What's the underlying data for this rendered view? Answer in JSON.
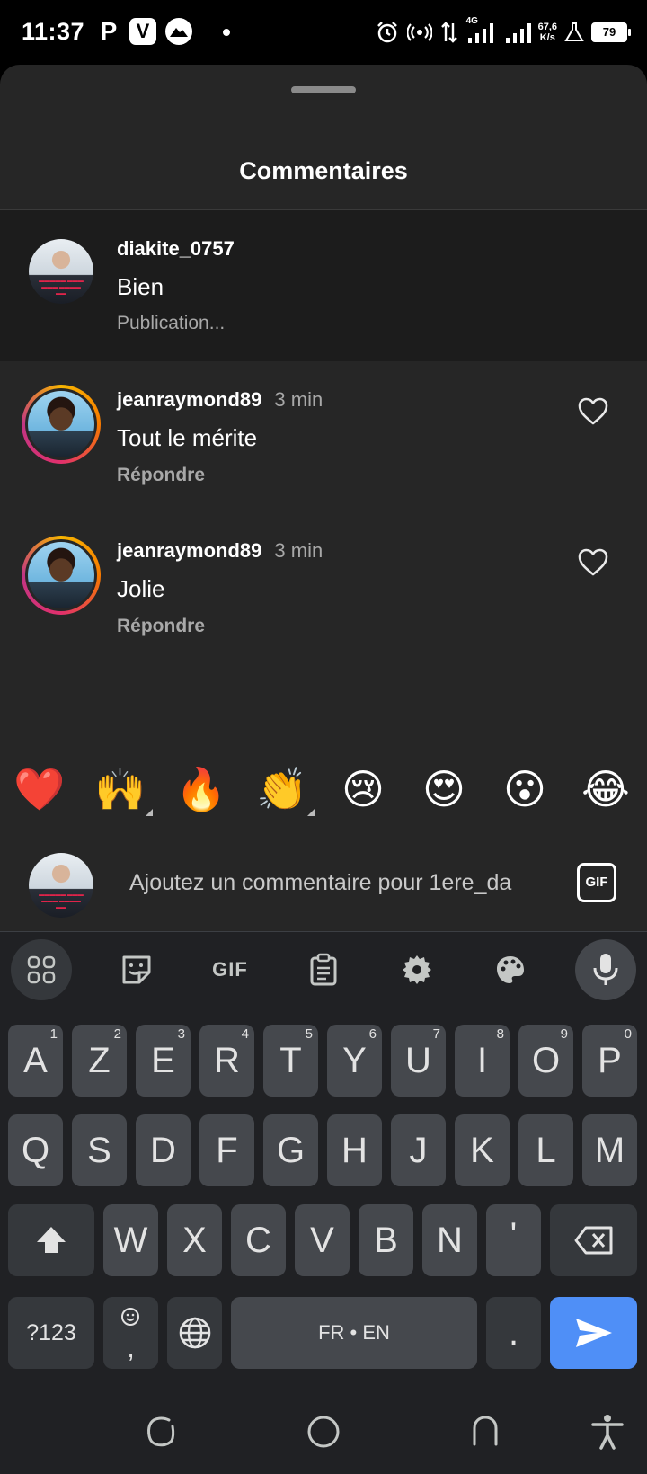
{
  "status_bar": {
    "time": "11:37",
    "apps": [
      "P",
      "V"
    ],
    "network": "4G",
    "speed_value": "67,6",
    "speed_unit": "K/s",
    "battery": "79"
  },
  "sheet": {
    "title": "Commentaires"
  },
  "pending_comment": {
    "username": "diakite_0757",
    "text": "Bien",
    "status": "Publication..."
  },
  "comments": [
    {
      "username": "jeanraymond89",
      "time": "3 min",
      "text": "Tout le mérite",
      "reply": "Répondre"
    },
    {
      "username": "jeanraymond89",
      "time": "3 min",
      "text": "Jolie",
      "reply": "Répondre"
    }
  ],
  "emoji_bar": [
    "❤️",
    "🙌",
    "🔥",
    "👏",
    "😢",
    "😍",
    "😮",
    "😂"
  ],
  "composer": {
    "placeholder": "Ajoutez un commentaire pour 1ere_da",
    "gif_label": "GIF"
  },
  "keyboard": {
    "toolbar_gif": "GIF",
    "row1": [
      {
        "key": "A",
        "hint": "1"
      },
      {
        "key": "Z",
        "hint": "2"
      },
      {
        "key": "E",
        "hint": "3"
      },
      {
        "key": "R",
        "hint": "4"
      },
      {
        "key": "T",
        "hint": "5"
      },
      {
        "key": "Y",
        "hint": "6"
      },
      {
        "key": "U",
        "hint": "7"
      },
      {
        "key": "I",
        "hint": "8"
      },
      {
        "key": "O",
        "hint": "9"
      },
      {
        "key": "P",
        "hint": "0"
      }
    ],
    "row2": [
      "Q",
      "S",
      "D",
      "F",
      "G",
      "H",
      "J",
      "K",
      "L",
      "M"
    ],
    "row3": [
      "W",
      "X",
      "C",
      "V",
      "B",
      "N",
      "'"
    ],
    "symbols": "?123",
    "comma": ",",
    "space": "FR • EN",
    "period": "."
  }
}
